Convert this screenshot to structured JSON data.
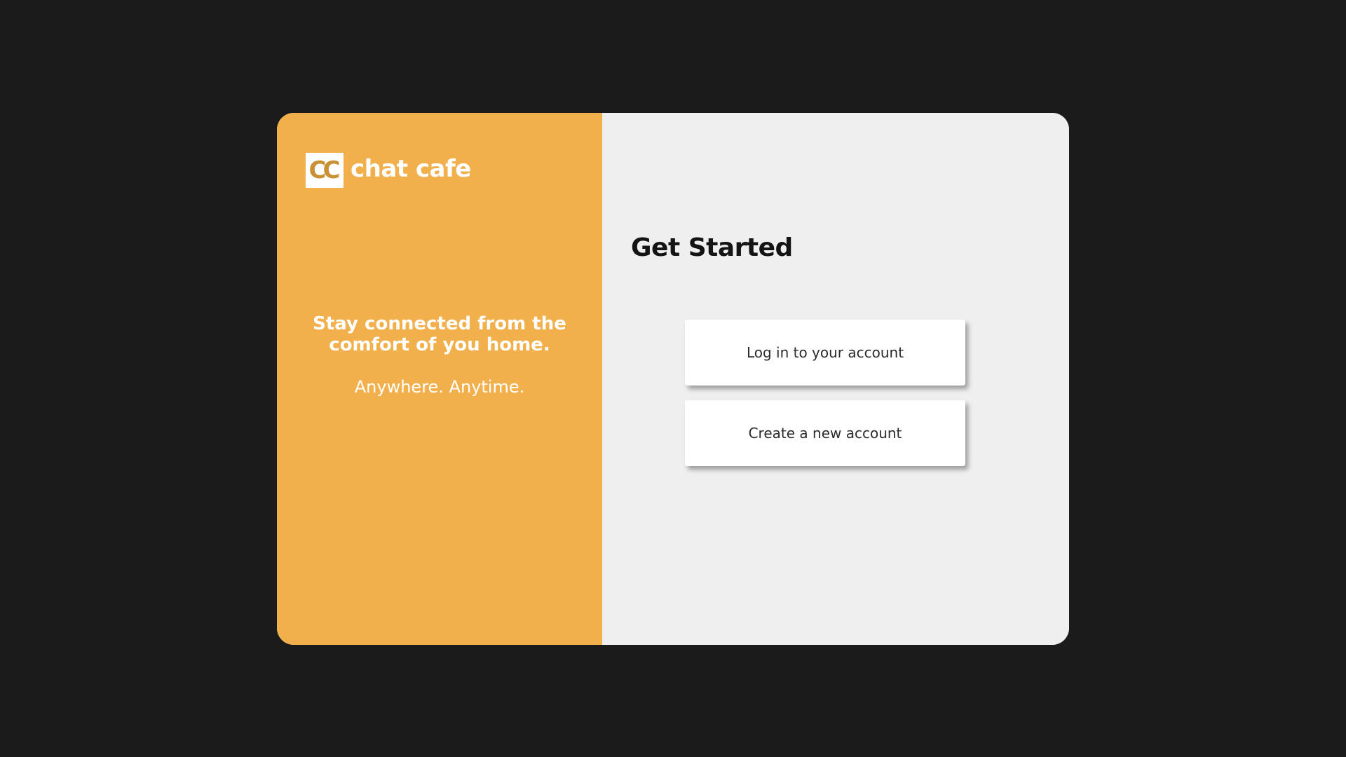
{
  "brand": {
    "logo_text": "CC",
    "name": "chat cafe"
  },
  "hero": {
    "tagline": "Stay connected from the comfort of you home.",
    "subtagline": "Anywhere. Anytime."
  },
  "main": {
    "title": "Get Started",
    "login_label": "Log in to your account",
    "create_label": "Create a new account"
  },
  "colors": {
    "background": "#1b1b1b",
    "accent": "#f2b04c",
    "panel": "#efefef",
    "button": "#ffffff"
  }
}
